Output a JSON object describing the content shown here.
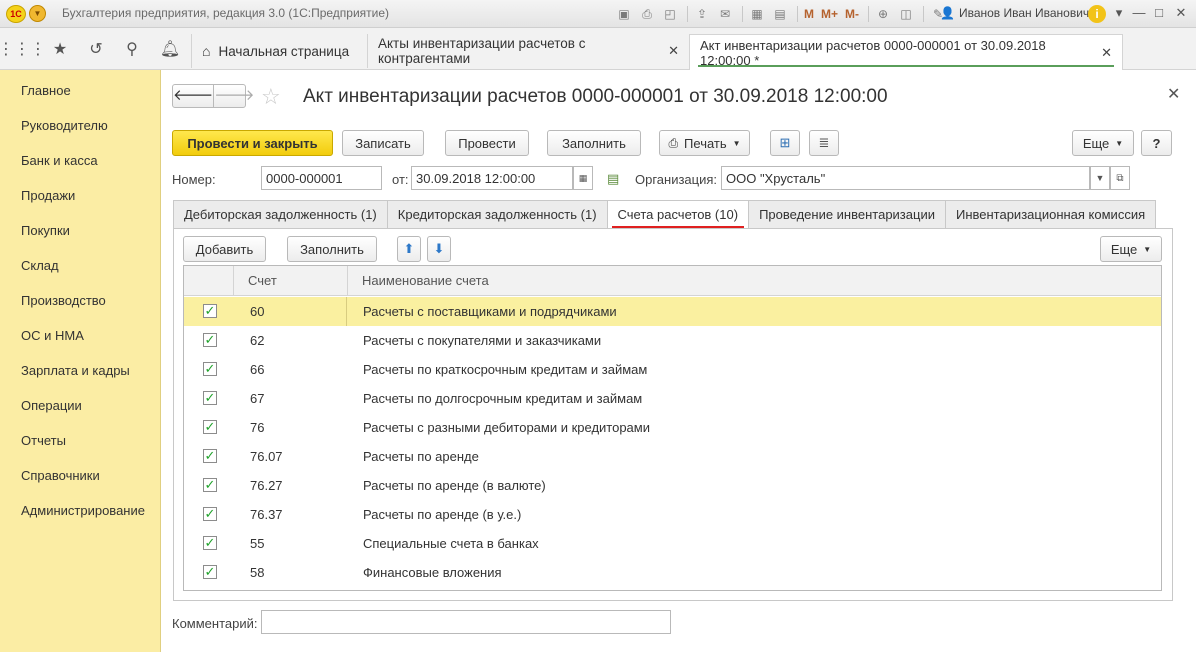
{
  "window": {
    "title": "Бухгалтерия предприятия, редакция 3.0  (1С:Предприятие)",
    "user": "Иванов Иван Иванович",
    "logo_text": "1С",
    "toolbar_m": [
      "M",
      "M+",
      "M-"
    ]
  },
  "nav": {
    "tabs": [
      {
        "label": "Начальная страница"
      },
      {
        "label": "Акты инвентаризации расчетов с контрагентами"
      },
      {
        "label": "Акт инвентаризации расчетов 0000-000001 от 30.09.2018 12:00:00 *"
      }
    ]
  },
  "sidebar": {
    "items": [
      {
        "label": "Главное"
      },
      {
        "label": "Руководителю"
      },
      {
        "label": "Банк и касса"
      },
      {
        "label": "Продажи"
      },
      {
        "label": "Покупки"
      },
      {
        "label": "Склад"
      },
      {
        "label": "Производство"
      },
      {
        "label": "ОС и НМА"
      },
      {
        "label": "Зарплата и кадры"
      },
      {
        "label": "Операции"
      },
      {
        "label": "Отчеты"
      },
      {
        "label": "Справочники"
      },
      {
        "label": "Администрирование"
      }
    ]
  },
  "form": {
    "title": "Акт инвентаризации расчетов 0000-000001 от 30.09.2018 12:00:00",
    "buttons": {
      "post_close": "Провести и закрыть",
      "save": "Записать",
      "post": "Провести",
      "fill": "Заполнить",
      "print": "Печать",
      "more": "Еще",
      "help": "?"
    },
    "number_label": "Номер:",
    "number_value": "0000-000001",
    "date_label": "от:",
    "date_value": "30.09.2018 12:00:00",
    "org_label": "Организация:",
    "org_value": "ООО \"Хрусталь\"",
    "tabs": [
      {
        "label": "Дебиторская задолженность (1)"
      },
      {
        "label": "Кредиторская задолженность (1)"
      },
      {
        "label": "Счета расчетов (10)"
      },
      {
        "label": "Проведение инвентаризации"
      },
      {
        "label": "Инвентаризационная комиссия"
      }
    ],
    "table_toolbar": {
      "add": "Добавить",
      "fill": "Заполнить",
      "more": "Еще"
    },
    "columns": {
      "account": "Счет",
      "name": "Наименование счета"
    },
    "rows": [
      {
        "account": "60",
        "name": "Расчеты с поставщиками и подрядчиками",
        "checked": true
      },
      {
        "account": "62",
        "name": "Расчеты с покупателями и заказчиками",
        "checked": true
      },
      {
        "account": "66",
        "name": "Расчеты по краткосрочным кредитам и займам",
        "checked": true
      },
      {
        "account": "67",
        "name": "Расчеты по долгосрочным кредитам и займам",
        "checked": true
      },
      {
        "account": "76",
        "name": "Расчеты с разными дебиторами и кредиторами",
        "checked": true
      },
      {
        "account": "76.07",
        "name": "Расчеты по аренде",
        "checked": true
      },
      {
        "account": "76.27",
        "name": "Расчеты по аренде (в валюте)",
        "checked": true
      },
      {
        "account": "76.37",
        "name": "Расчеты по аренде (в у.е.)",
        "checked": true
      },
      {
        "account": "55",
        "name": "Специальные счета в банках",
        "checked": true
      },
      {
        "account": "58",
        "name": "Финансовые вложения",
        "checked": true
      }
    ],
    "comment_label": "Комментарий:",
    "comment_value": ""
  },
  "colors": {
    "sidebar_bg": "#fbeda4",
    "primary_button": "#f2cc0c",
    "selected_row": "#faf0a0",
    "active_tab_underline": "#e02020",
    "checkmark": "#21a32c"
  }
}
